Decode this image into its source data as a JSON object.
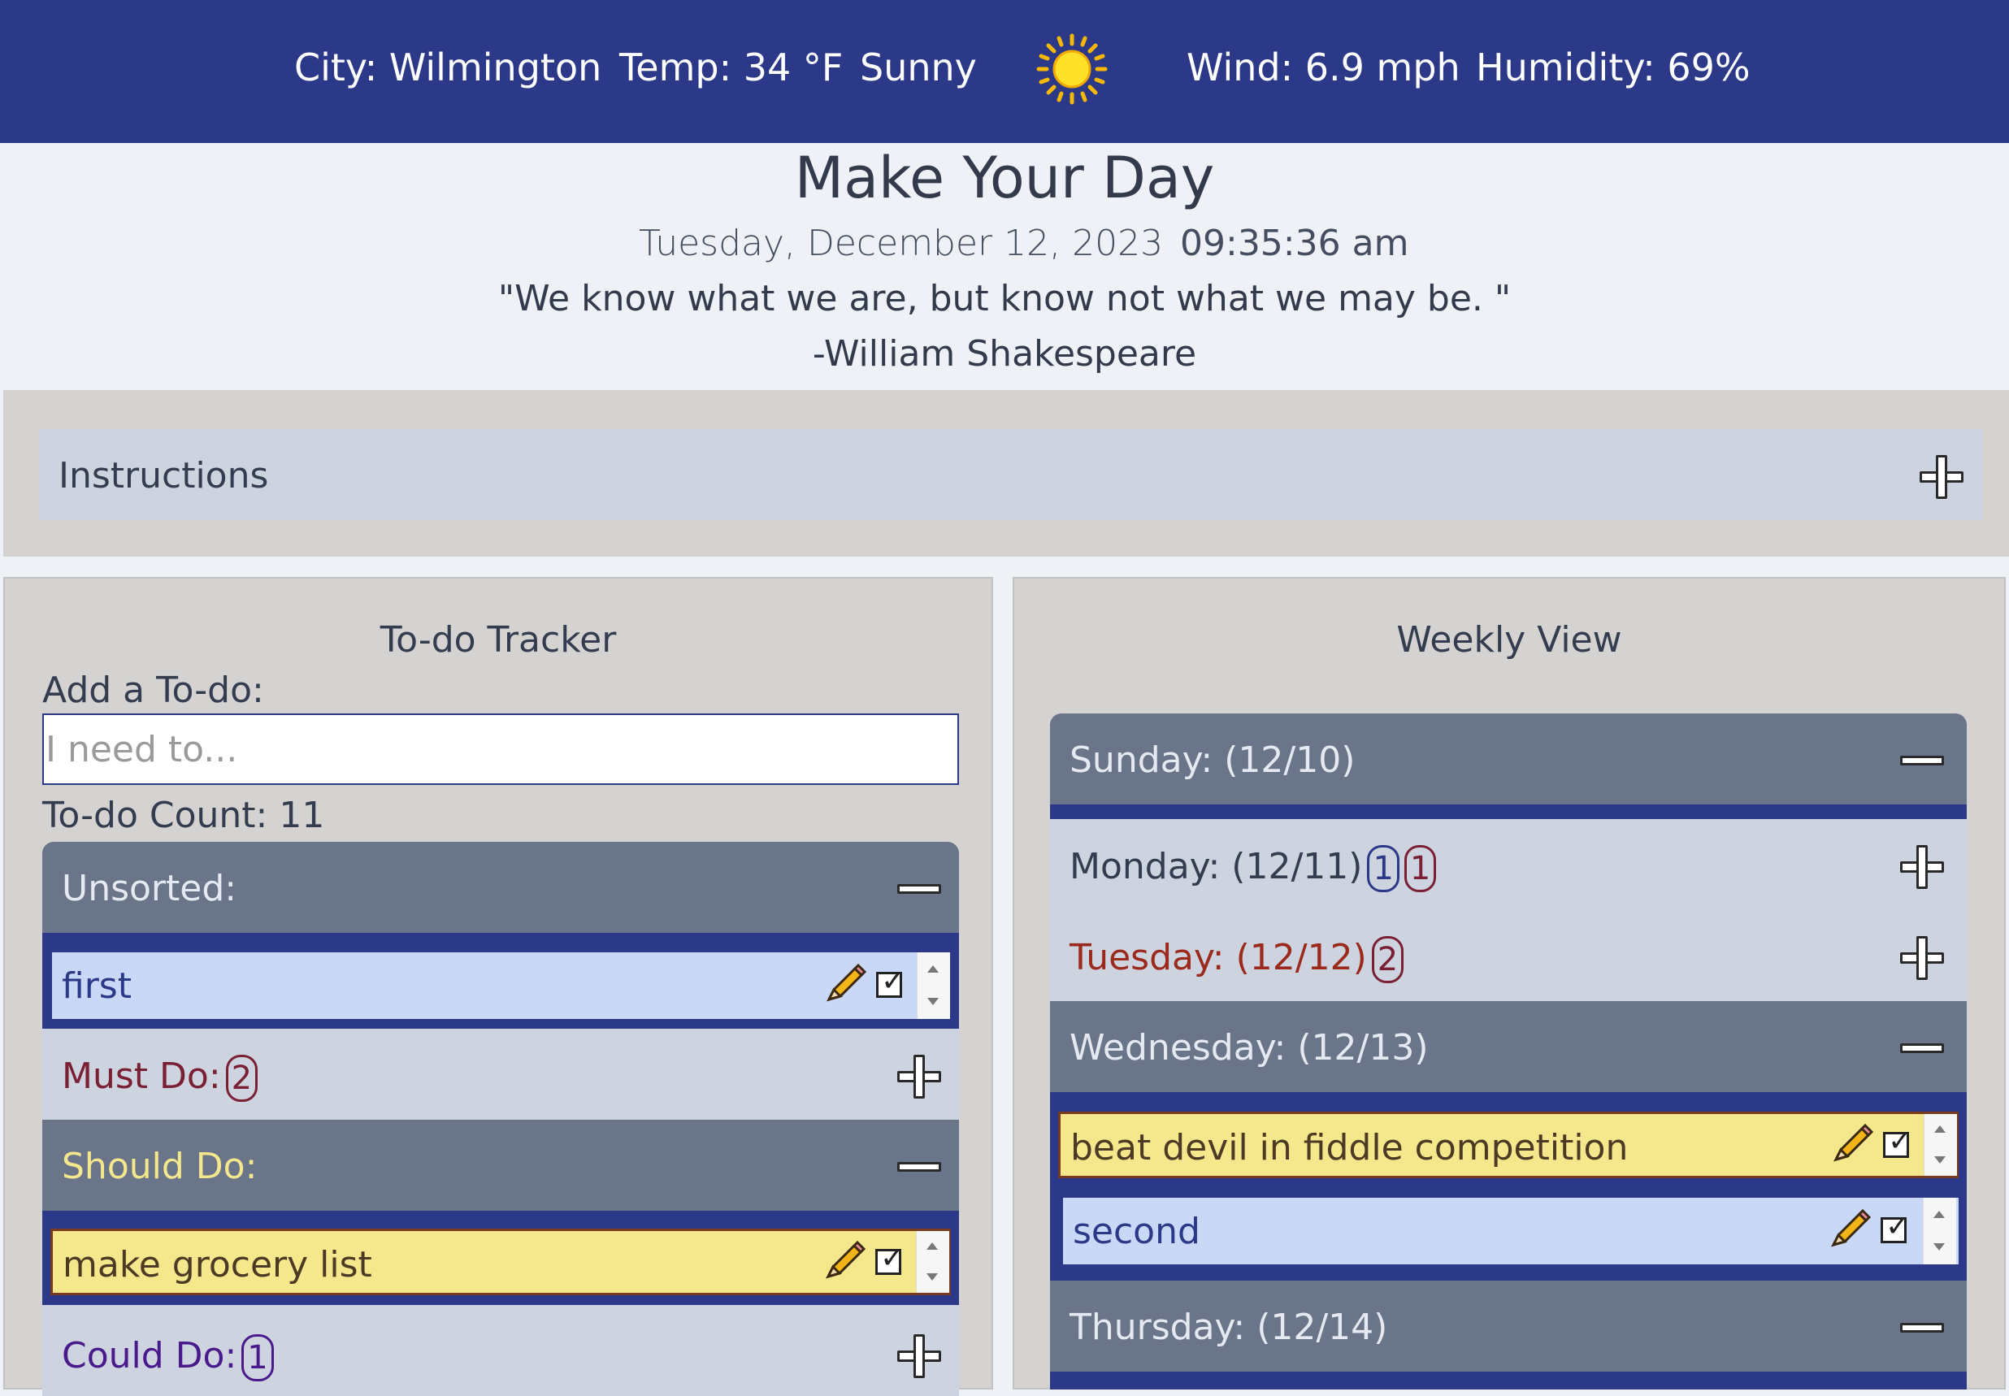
{
  "weather": {
    "city": "City: Wilmington",
    "temp": "Temp: 34 °F",
    "condition": "Sunny",
    "wind": "Wind: 6.9 mph",
    "humidity": "Humidity: 69%",
    "icon": "sun-icon"
  },
  "header": {
    "title": "Make Your Day",
    "date": "Tuesday, December 12, 2023",
    "time": "09:35:36 am",
    "quote": "\"We know what we are, but know not what we may be. \"",
    "author": "-William Shakespeare"
  },
  "instructions": {
    "label": "Instructions"
  },
  "todo": {
    "title": "To-do Tracker",
    "add_label": "Add a To-do:",
    "placeholder": "I need to...",
    "count": "To-do Count: 11",
    "sections": {
      "unsorted": {
        "label": "Unsorted:",
        "items": [
          "first"
        ]
      },
      "must": {
        "label": "Must Do:",
        "badge": "2"
      },
      "should": {
        "label": "Should Do:",
        "items": [
          "make grocery list"
        ]
      },
      "could": {
        "label": "Could Do:",
        "badge": "1"
      }
    }
  },
  "weekly": {
    "title": "Weekly View",
    "days": {
      "sunday": {
        "label": "Sunday: (12/10)"
      },
      "monday": {
        "label": "Monday: (12/11)",
        "badge_blue": "1",
        "badge_red": "1"
      },
      "tuesday": {
        "label": "Tuesday: (12/12)",
        "badge_red": "2"
      },
      "wednesday": {
        "label": "Wednesday: (12/13)",
        "items": [
          "beat devil in fiddle competition",
          "second"
        ]
      },
      "thursday": {
        "label": "Thursday: (12/14)"
      }
    }
  },
  "colors": {
    "navy": "#2c3988",
    "slate": "#6b7589",
    "light_panel": "#cdd4e0",
    "must_red": "#7a2035",
    "should_yellow": "#f5e78c",
    "could_purple": "#4a1a8c",
    "item_blue": "#cad8f8",
    "today_red": "#9b2a1c"
  }
}
